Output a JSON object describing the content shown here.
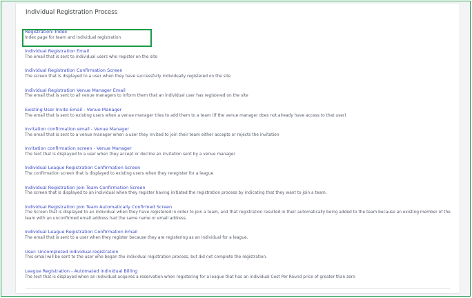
{
  "page": {
    "title": "Individual Registration Process"
  },
  "colors": {
    "accent_link": "#3b4bc4",
    "highlight_green": "#1a9a46",
    "description_text": "#555b66"
  },
  "items": [
    {
      "title": "Registration: Index",
      "description": "Index page for team and individual registration"
    },
    {
      "title": "Individual Registration Email",
      "description": "The email that is sent to individual users who register on the site"
    },
    {
      "title": "Individual Registration Confirmation Screen",
      "description": "The screen that is displayed to a user when they have successfully individually registered on the site"
    },
    {
      "title": "Individual Registration Venue Manager Email",
      "description": "The email that is sent to all venue managers to inform them that an individual user has registered on the site"
    },
    {
      "title": "Existing User Invite Email - Venue Manager",
      "description": "The email that is sent to existing users when a venue manager tries to add them to a team (if the venue manager does not already have access to that user)"
    },
    {
      "title": "Invitation confirmation email - Venue Manager",
      "description": "The email that is sent to a venue manager when a user they invited to join their team either accepts or rejects the invitation"
    },
    {
      "title": "Invitation confirmation screen - Venue Manager",
      "description": "The text that is displayed to a user when they accept or decline an invitation sent by a venue manager"
    },
    {
      "title": "Individual League Registration Confirmation Screen",
      "description": "The confirmation screen that is displayed to existing users when they reregister for a league"
    },
    {
      "title": "Individual Registration Join Team Confirmation Screen",
      "description": "The screen that is displayed to an individual when they register having initiated the registration process by indicating that they want to join a team."
    },
    {
      "title": "Individual Registration Join Team Automatically Confirmed Screen",
      "description": "The Screen that is displayed to an individual when they have registered in order to join a team, and that registration resulted in their automatically being added to the team because an existing member of the team with an unconfirmed email address had the same name or email address."
    },
    {
      "title": "Individual League Registration Confirmation Email",
      "description": "The email that is sent to a user when they register because they are registering as an individual for a league."
    },
    {
      "title": "User: Uncompleted individual registration",
      "description": "This email will be sent to the user who began the individual registration process, but did not complete the registration."
    },
    {
      "title": "League Registration - Automated Individual Billing",
      "description": "The text that is displayed when an individual acquires a reservation when registering for a league that has an individual Cost Per Round price of greater than zero"
    }
  ]
}
